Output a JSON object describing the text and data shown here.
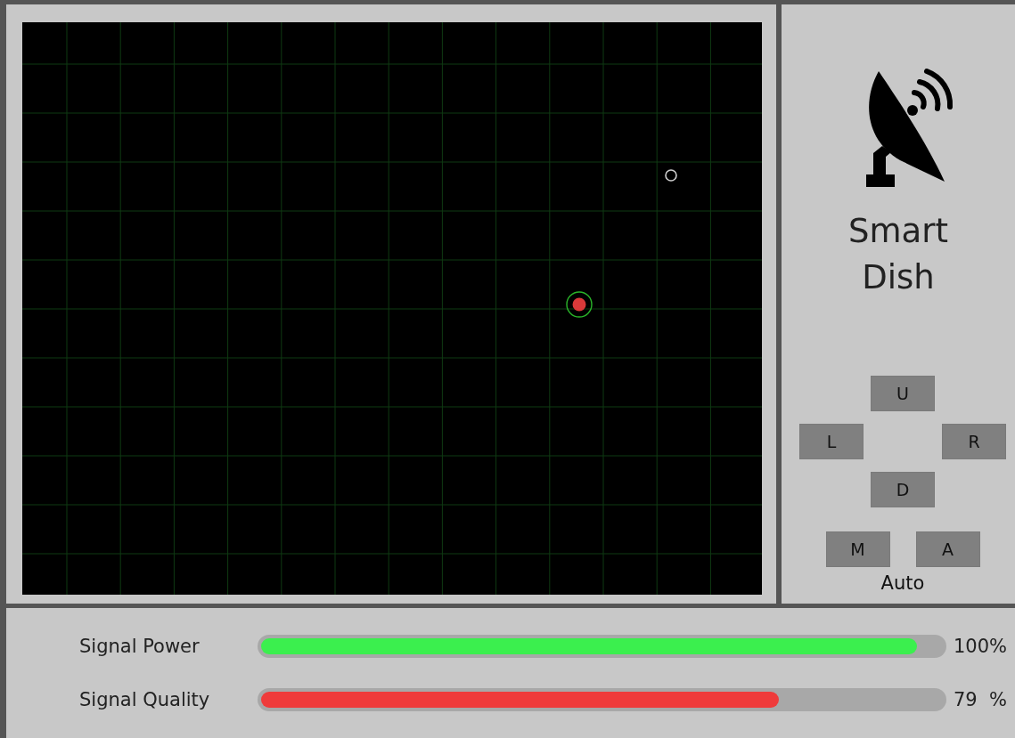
{
  "app": {
    "title": "Smart Dish"
  },
  "direction_buttons": [
    {
      "label": "U",
      "kind": "up"
    },
    {
      "label": "L",
      "kind": "left"
    },
    {
      "label": "R",
      "kind": "right"
    },
    {
      "label": "D",
      "kind": "down"
    }
  ],
  "mode_buttons": [
    "M",
    "A"
  ],
  "mode_status": "Auto",
  "meters": [
    {
      "label": "Signal Power",
      "level": 1.0,
      "reading": "100%",
      "color": "#3bef4e"
    },
    {
      "label": "Signal Quality",
      "level": 0.79,
      "reading": "79  %",
      "color": "#ef3b3b"
    }
  ]
}
